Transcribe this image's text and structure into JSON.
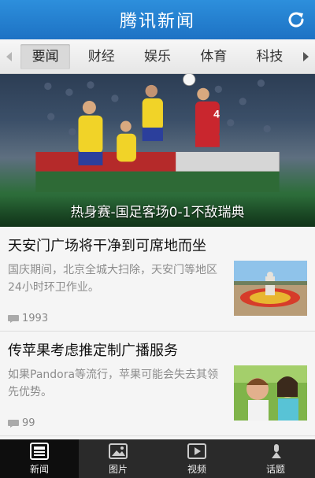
{
  "header": {
    "title": "腾讯新闻",
    "refresh_icon": "refresh-icon"
  },
  "tabs": [
    {
      "label": "要闻",
      "active": true
    },
    {
      "label": "财经",
      "active": false
    },
    {
      "label": "娱乐",
      "active": false
    },
    {
      "label": "体育",
      "active": false
    },
    {
      "label": "科技",
      "active": false
    }
  ],
  "hero": {
    "caption": "热身赛-国足客场0-1不敌瑞典"
  },
  "news": [
    {
      "headline": "天安门广场将干净到可席地而坐",
      "summary": "国庆期间，北京全城大扫除，天安门等地区24小时环卫作业。",
      "comments": "1993"
    },
    {
      "headline": "传苹果考虑推定制广播服务",
      "summary": "如果Pandora等流行，苹果可能会失去其领先优势。",
      "comments": "99"
    }
  ],
  "bottom_nav": [
    {
      "label": "新闻",
      "icon": "news-icon",
      "active": true
    },
    {
      "label": "图片",
      "icon": "picture-icon",
      "active": false
    },
    {
      "label": "视频",
      "icon": "video-icon",
      "active": false
    },
    {
      "label": "话题",
      "icon": "topic-icon",
      "active": false
    }
  ],
  "colors": {
    "header": "#1d72c4",
    "bottom_nav": "#2a2a2a"
  }
}
